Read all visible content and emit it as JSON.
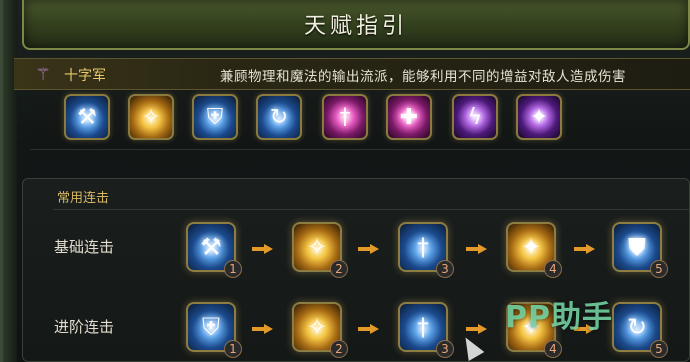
{
  "window": {
    "title": "天赋指引"
  },
  "class_banner": {
    "icon": "staff-icon",
    "class_name": "十字军",
    "description": "兼顾物理和魔法的输出流派，能够利用不同的增益对敌人造成伤害"
  },
  "skill_strip": [
    {
      "icon": "blue-hammer-icon",
      "color": "blue",
      "glyph": "⚒"
    },
    {
      "icon": "gold-angel-icon",
      "color": "gold",
      "glyph": "✧"
    },
    {
      "icon": "blue-shrine-icon",
      "color": "blue",
      "glyph": "⛨"
    },
    {
      "icon": "blue-swirl-icon",
      "color": "blue",
      "glyph": "↻"
    },
    {
      "icon": "pink-sword-icon",
      "color": "pink",
      "glyph": "†"
    },
    {
      "icon": "pink-cross-icon",
      "color": "pink",
      "glyph": "✚"
    },
    {
      "icon": "purple-lightning-icon",
      "color": "purple",
      "glyph": "ϟ"
    },
    {
      "icon": "purple-spark-icon",
      "color": "purple",
      "glyph": "✦"
    }
  ],
  "combos": {
    "section_label": "常用连击",
    "rows": [
      {
        "label": "基础连击",
        "skills": [
          {
            "num": "1",
            "icon": "blue-hammer-icon",
            "color": "blue",
            "glyph": "⚒"
          },
          {
            "num": "2",
            "icon": "gold-angel-icon",
            "color": "gold",
            "glyph": "✧"
          },
          {
            "num": "3",
            "icon": "blue-sword-shield-icon",
            "color": "blue",
            "glyph": "†"
          },
          {
            "num": "4",
            "icon": "gold-sword-icon",
            "color": "gold",
            "glyph": "✦"
          },
          {
            "num": "5",
            "icon": "blue-broken-shield-icon",
            "color": "blue",
            "glyph": "⛊"
          }
        ]
      },
      {
        "label": "进阶连击",
        "skills": [
          {
            "num": "1",
            "icon": "blue-shrine-icon",
            "color": "blue",
            "glyph": "⛨"
          },
          {
            "num": "2",
            "icon": "gold-wings-icon",
            "color": "gold",
            "glyph": "✧"
          },
          {
            "num": "3",
            "icon": "blue-sword-shield-icon",
            "color": "blue",
            "glyph": "†"
          },
          {
            "num": "4",
            "icon": "gold-sword-icon",
            "color": "gold",
            "glyph": "✦"
          },
          {
            "num": "5",
            "icon": "blue-swirl-icon",
            "color": "blue",
            "glyph": "↻"
          }
        ]
      }
    ]
  },
  "watermark": "PP助手"
}
